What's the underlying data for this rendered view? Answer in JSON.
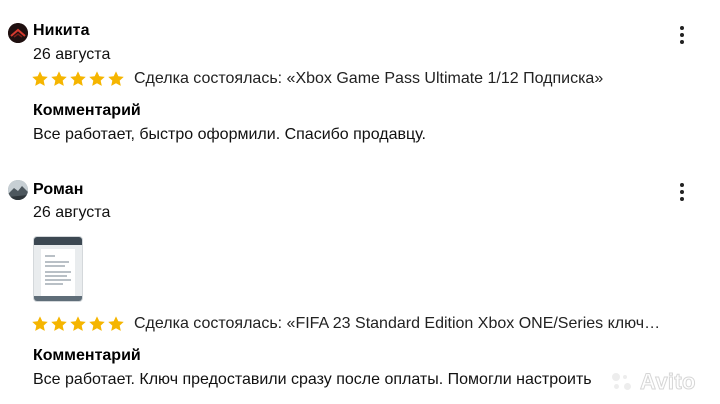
{
  "reviews": [
    {
      "author": "Никита",
      "date": "26 августа",
      "rating": 5,
      "deal": "Сделка состоялась: «Xbox Game Pass Ultimate 1/12 Подписка»",
      "comment_heading": "Комментарий",
      "comment": "Все работает, быстро оформили. Спасибо продавцу."
    },
    {
      "author": "Роман",
      "date": "26 августа",
      "rating": 5,
      "deal": "Сделка состоялась: «FIFA 23 Standard Edition Xbox ONE/Series ключ…",
      "comment_heading": "Комментарий",
      "comment": "Все работает. Ключ предоставили сразу после оплаты. Помогли настроить"
    }
  ],
  "watermark": {
    "brand": "Avito"
  },
  "colors": {
    "star": "#f5b500",
    "text": "#000000",
    "muted": "#222222"
  },
  "icons": {
    "more": "more-vertical-icon",
    "star": "star-icon"
  }
}
